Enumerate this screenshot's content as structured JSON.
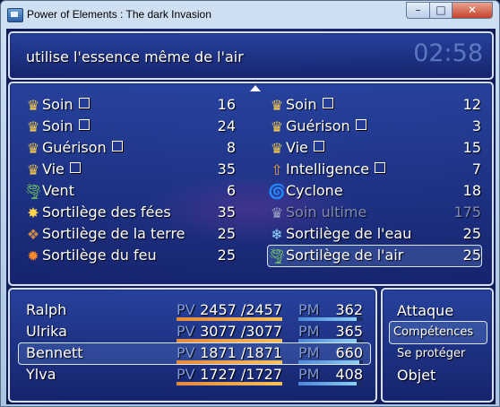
{
  "window": {
    "title": "Power of Elements : The dark Invasion",
    "controls": {
      "minimize": "–",
      "maximize": "□",
      "close": "✕"
    }
  },
  "help": {
    "text": "utilise l'essence même de l'air",
    "clock": "02:58"
  },
  "skills": {
    "left": [
      {
        "icon": "crown-icon",
        "glyph": "♛",
        "color": "#f3c84a",
        "name": "Soin",
        "checkbox": true,
        "cost": "16"
      },
      {
        "icon": "crown-icon",
        "glyph": "♛",
        "color": "#f3c84a",
        "name": "Soin",
        "checkbox": true,
        "cost": "24"
      },
      {
        "icon": "crown-icon",
        "glyph": "♛",
        "color": "#f3c84a",
        "name": "Guérison",
        "checkbox": true,
        "cost": "8"
      },
      {
        "icon": "crown-icon",
        "glyph": "♛",
        "color": "#f3c84a",
        "name": "Vie",
        "checkbox": true,
        "cost": "35"
      },
      {
        "icon": "tornado-icon",
        "glyph": "🌪",
        "color": "#7fe35a",
        "name": "Vent",
        "checkbox": false,
        "cost": "6"
      },
      {
        "icon": "sparkle-icon",
        "glyph": "✸",
        "color": "#ffd34a",
        "name": "Sortilège des fées",
        "checkbox": false,
        "cost": "35"
      },
      {
        "icon": "rock-icon",
        "glyph": "❖",
        "color": "#c9884a",
        "name": "Sortilège de la terre",
        "checkbox": false,
        "cost": "25"
      },
      {
        "icon": "fire-icon",
        "glyph": "✹",
        "color": "#ff8a2a",
        "name": "Sortilège du feu",
        "checkbox": false,
        "cost": "25"
      }
    ],
    "right": [
      {
        "icon": "crown-icon",
        "glyph": "♛",
        "color": "#f3c84a",
        "name": "Soin",
        "checkbox": true,
        "cost": "12",
        "disabled": false
      },
      {
        "icon": "crown-icon",
        "glyph": "♛",
        "color": "#f3c84a",
        "name": "Guérison",
        "checkbox": true,
        "cost": "3",
        "disabled": false
      },
      {
        "icon": "crown-icon",
        "glyph": "♛",
        "color": "#f3c84a",
        "name": "Vie",
        "checkbox": true,
        "cost": "15",
        "disabled": false
      },
      {
        "icon": "int-up-icon",
        "glyph": "⇧",
        "color": "#f0a03a",
        "name": "Intelligence",
        "checkbox": true,
        "cost": "7",
        "disabled": false
      },
      {
        "icon": "cyclone-icon",
        "glyph": "🌀",
        "color": "#7fe35a",
        "name": "Cyclone",
        "checkbox": false,
        "cost": "18",
        "disabled": false
      },
      {
        "icon": "crown-icon",
        "glyph": "♛",
        "color": "#9aa3bf",
        "name": "Soin ultime",
        "checkbox": false,
        "cost": "175",
        "disabled": true
      },
      {
        "icon": "water-icon",
        "glyph": "❄",
        "color": "#8fd6ff",
        "name": "Sortilège de l'eau",
        "checkbox": false,
        "cost": "25",
        "disabled": false
      },
      {
        "icon": "air-icon",
        "glyph": "🌪",
        "color": "#7fe35a",
        "name": "Sortilège de l'air",
        "checkbox": false,
        "cost": "25",
        "disabled": false,
        "selected": true
      }
    ]
  },
  "party": {
    "labels": {
      "pv": "PV",
      "pm": "PM"
    },
    "members": [
      {
        "name": "Ralph",
        "pv": "2457 /2457",
        "pm": "362",
        "pv_fill": 1.0,
        "pm_fill": 0.9
      },
      {
        "name": "Ulrika",
        "pv": "3077 /3077",
        "pm": "365",
        "pv_fill": 1.0,
        "pm_fill": 0.9
      },
      {
        "name": "Bennett",
        "pv": "1871 /1871",
        "pm": "660",
        "pv_fill": 1.0,
        "pm_fill": 0.95,
        "selected": true
      },
      {
        "name": "Ylva",
        "pv": "1727 /1727",
        "pm": "408",
        "pv_fill": 1.0,
        "pm_fill": 0.9
      }
    ]
  },
  "commands": [
    {
      "label": "Attaque",
      "active": false,
      "small": false
    },
    {
      "label": "Compétences",
      "active": true,
      "small": false
    },
    {
      "label": "Se protéger",
      "active": false,
      "small": true
    },
    {
      "label": "Objet",
      "active": false,
      "small": false
    }
  ]
}
